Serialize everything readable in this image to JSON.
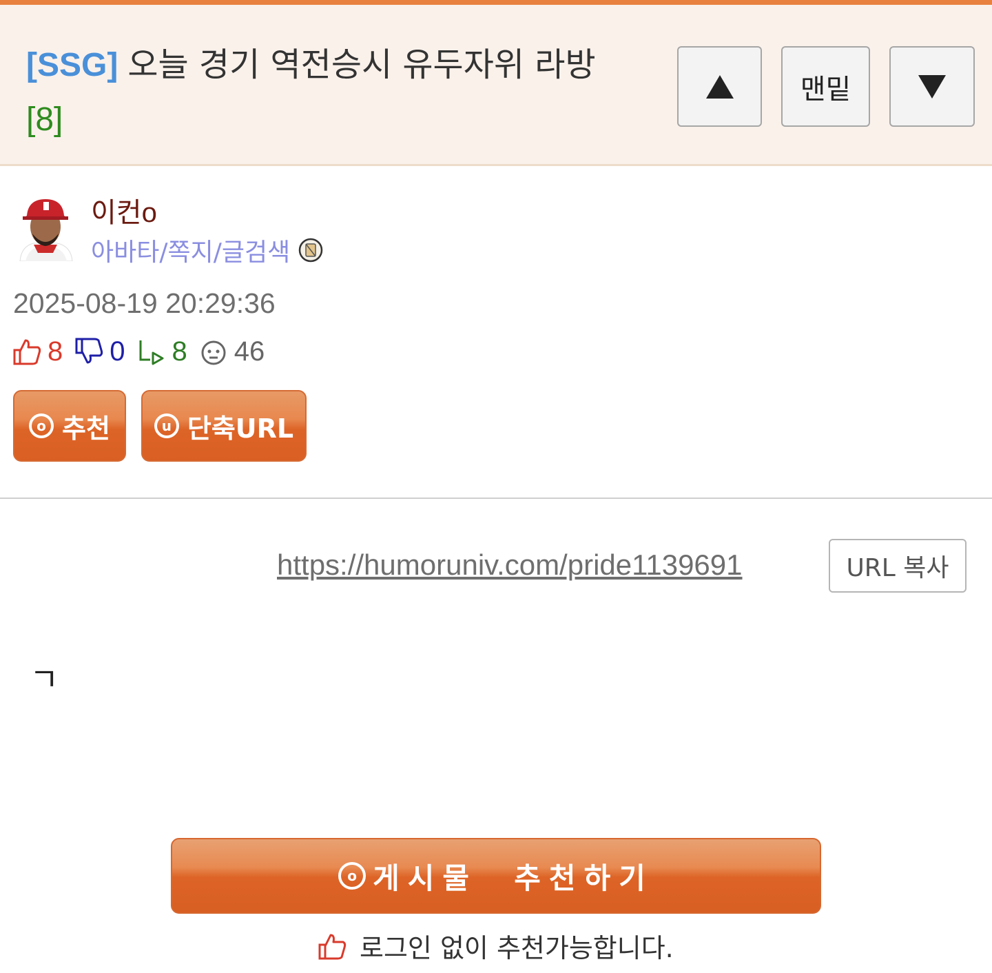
{
  "header": {
    "category": "[SSG]",
    "title": "오늘 경기 역전승시 유두자위 라방",
    "comment_count": "[8]",
    "nav": {
      "bottom_label": "맨밑"
    }
  },
  "author": {
    "name": "이컨o",
    "links": "아바타/쪽지/글검색"
  },
  "post": {
    "datetime": "2025-08-19 20:29:36",
    "stats": {
      "upvotes": "8",
      "downvotes": "0",
      "replies": "8",
      "views": "46"
    },
    "buttons": {
      "recommend": "추천",
      "short_url": "단축URL"
    },
    "url": "https://humoruniv.com/pride1139691",
    "url_copy_label": "URL 복사",
    "body": "ㄱ"
  },
  "footer": {
    "recommend_button": "게시물  추천하기",
    "note": "로그인 없이 추천가능합니다."
  },
  "colors": {
    "accent": "#e8813f",
    "button_orange": "#dd6427",
    "category_blue": "#4a90d9",
    "count_green": "#2e8b1e",
    "author_red": "#6b1a10",
    "link_purple": "#8a8ee0"
  }
}
